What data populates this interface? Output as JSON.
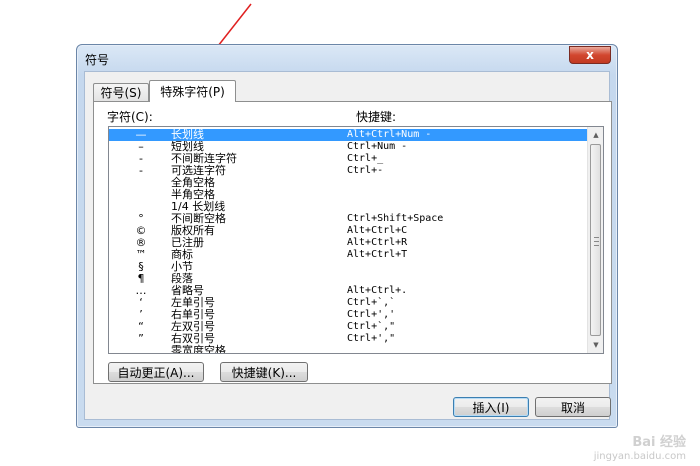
{
  "dialog": {
    "title": "符号",
    "close_glyph": "x"
  },
  "tabs": [
    {
      "label": "符号(S)",
      "active": false
    },
    {
      "label": "特殊字符(P)",
      "active": true
    }
  ],
  "list": {
    "header_chars": "字符(C):",
    "header_keys": "快捷键:",
    "rows": [
      {
        "symbol": "—",
        "name": "长划线",
        "key": "Alt+Ctrl+Num -",
        "selected": true
      },
      {
        "symbol": "–",
        "name": "短划线",
        "key": "Ctrl+Num -"
      },
      {
        "symbol": "-",
        "name": "不间断连字符",
        "key": "Ctrl+_"
      },
      {
        "symbol": "-",
        "name": "可选连字符",
        "key": "Ctrl+-"
      },
      {
        "symbol": "",
        "name": "全角空格",
        "key": ""
      },
      {
        "symbol": "",
        "name": "半角空格",
        "key": ""
      },
      {
        "symbol": "",
        "name": "1/4 长划线",
        "key": ""
      },
      {
        "symbol": "°",
        "name": "不间断空格",
        "key": "Ctrl+Shift+Space"
      },
      {
        "symbol": "©",
        "name": "版权所有",
        "key": "Alt+Ctrl+C"
      },
      {
        "symbol": "®",
        "name": "已注册",
        "key": "Alt+Ctrl+R"
      },
      {
        "symbol": "™",
        "name": "商标",
        "key": "Alt+Ctrl+T"
      },
      {
        "symbol": "§",
        "name": "小节",
        "key": ""
      },
      {
        "symbol": "¶",
        "name": "段落",
        "key": ""
      },
      {
        "symbol": "…",
        "name": "省略号",
        "key": "Alt+Ctrl+."
      },
      {
        "symbol": "‘",
        "name": "左单引号",
        "key": "Ctrl+`,`"
      },
      {
        "symbol": "’",
        "name": "右单引号",
        "key": "Ctrl+',' "
      },
      {
        "symbol": "“",
        "name": "左双引号",
        "key": "Ctrl+`,\""
      },
      {
        "symbol": "”",
        "name": "右双引号",
        "key": "Ctrl+',\""
      },
      {
        "symbol": "",
        "name": "零宽度空格",
        "key": ""
      }
    ]
  },
  "buttons": {
    "autocorrect": "自动更正(A)...",
    "shortcut": "快捷键(K)...",
    "insert": "插入(I)",
    "cancel": "取消"
  },
  "watermark": {
    "text": "Bai 经验",
    "url": "jingyan.baidu.com"
  },
  "annotation": {
    "arrow_color": "#e02020"
  }
}
